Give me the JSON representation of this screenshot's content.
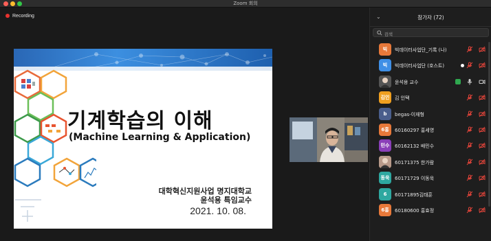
{
  "window": {
    "title": "Zoom 회의"
  },
  "recording": {
    "label": "Recording",
    "color": "#e8322f"
  },
  "slide": {
    "title": "기계학습의 이해",
    "subtitle": "(Machine Learning & Application)",
    "org": "대학혁신지원사업 명지대학교",
    "presenter": "윤석용 특임교수",
    "date": "2021. 10. 08."
  },
  "panel": {
    "title": "참가자 (72)",
    "search_placeholder": "검색",
    "participants": [
      {
        "avatar_text": "빅",
        "avatar_color": "#e8793a",
        "name": "빅데이터사업단_기록 (나)",
        "icons": [
          "mic-muted-icon",
          "video-off-icon"
        ]
      },
      {
        "avatar_text": "빅",
        "avatar_color": "#3f8fe6",
        "name": "빅데이터사업단 (호스트)",
        "icons": [
          "mic-muted-icon",
          "video-off-icon"
        ]
      },
      {
        "avatar_text": "",
        "avatar_color": "#555555",
        "name": "윤석용 교수",
        "icons": [
          "speaking-badge",
          "mic-on-icon",
          "video-on-icon"
        ]
      },
      {
        "avatar_text": "김인",
        "avatar_color": "#f0a020",
        "name": "김 인택",
        "icons": [
          "mic-muted-icon",
          "video-off-icon"
        ]
      },
      {
        "avatar_text": "b",
        "avatar_color": "#4a5e8c",
        "name": "begas-이재형",
        "icons": [
          "mic-muted-icon",
          "video-off-icon"
        ]
      },
      {
        "avatar_text": "6홍",
        "avatar_color": "#e8793a",
        "name": "60160297 홍세영",
        "icons": [
          "mic-muted-icon",
          "video-off-icon"
        ]
      },
      {
        "avatar_text": "민수",
        "avatar_color": "#8a3fb8",
        "name": "60162132 배민수",
        "icons": [
          "mic-muted-icon",
          "video-off-icon"
        ]
      },
      {
        "avatar_text": "",
        "avatar_color": "#b89a8a",
        "name": "60171375 한가람",
        "icons": [
          "mic-muted-icon",
          "video-off-icon"
        ]
      },
      {
        "avatar_text": "동욱",
        "avatar_color": "#2ea8a0",
        "name": "60171729 이동욱",
        "icons": [
          "mic-muted-icon",
          "video-off-icon"
        ]
      },
      {
        "avatar_text": "6",
        "avatar_color": "#2ea8a0",
        "name": "60171895김태훈",
        "icons": [
          "mic-muted-icon",
          "video-off-icon"
        ]
      },
      {
        "avatar_text": "6홍",
        "avatar_color": "#e8793a",
        "name": "60180600 홍효정",
        "icons": [
          "mic-muted-icon",
          "video-off-icon"
        ]
      }
    ]
  }
}
